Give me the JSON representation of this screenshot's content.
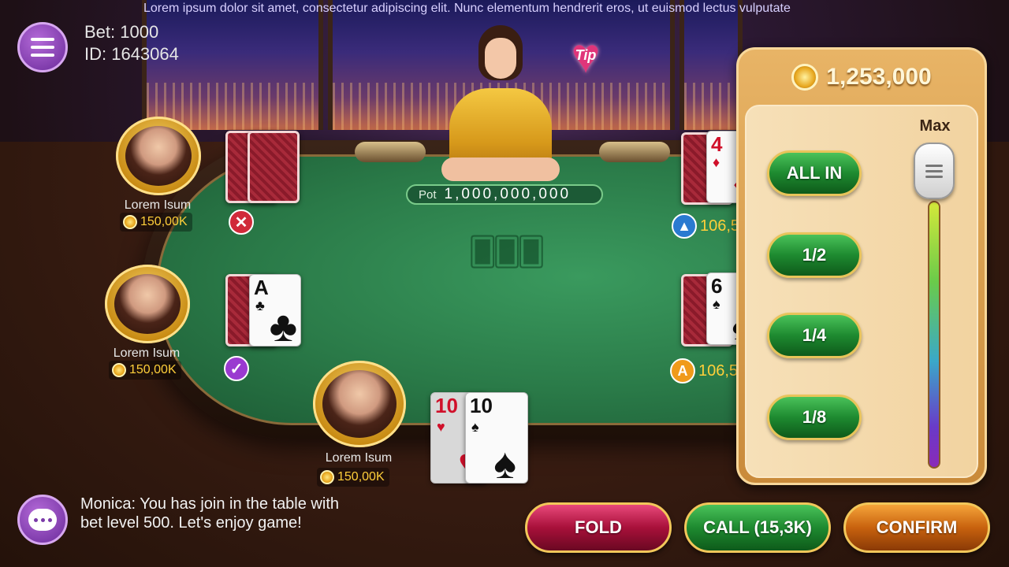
{
  "marquee": "Lorem ipsum dolor sit amet, consectetur adipiscing elit. Nunc elementum hendrerit eros, ut euismod lectus vulputate",
  "header": {
    "bet": "Bet: 1000",
    "id": "ID: 1643064"
  },
  "tip_label": "Tip",
  "pot": {
    "label": "Pot",
    "value": "1,000,000,000"
  },
  "players": [
    {
      "name": "Lorem Isum",
      "chips": "150,00K",
      "status": "folded"
    },
    {
      "name": "Lorem Isum",
      "chips": "150,00K",
      "status": "checked"
    },
    {
      "name": "Lorem Isum",
      "chips": "150,00K",
      "status": "self"
    }
  ],
  "right_players": [
    {
      "chips": "106,5",
      "badge": "raise",
      "card_rank": "4",
      "card_suit": "♦",
      "suit_color": "red"
    },
    {
      "chips": "106,5",
      "badge": "A",
      "card_rank": "6",
      "card_suit": "♠",
      "suit_color": "black"
    }
  ],
  "cards": {
    "p2_card": {
      "rank": "A",
      "suit": "♣"
    },
    "my_cards": [
      {
        "rank": "10",
        "suit": "♥"
      },
      {
        "rank": "10",
        "suit": "♠"
      }
    ]
  },
  "bet_panel": {
    "balance": "1,253,000",
    "max_label": "Max",
    "options": [
      "ALL IN",
      "1/2",
      "1/4",
      "1/8"
    ],
    "slider_level": 1.0
  },
  "actions": {
    "fold": "FOLD",
    "call": "CALL (15,3K)",
    "confirm": "CONFIRM"
  },
  "chat": {
    "message": "Monica: You has join in the table with bet level 500. Let's enjoy game!"
  },
  "colors": {
    "felt": "#2a7a48",
    "gold": "#f2c75a",
    "fold": "#a8103a",
    "call": "#1e8a30",
    "confirm": "#c8620e"
  },
  "icons": [
    "menu-icon",
    "coin-icon",
    "fold-x-icon",
    "check-icon",
    "raise-arrow-icon",
    "all-in-a-icon",
    "chat-icon",
    "heart-icon"
  ]
}
